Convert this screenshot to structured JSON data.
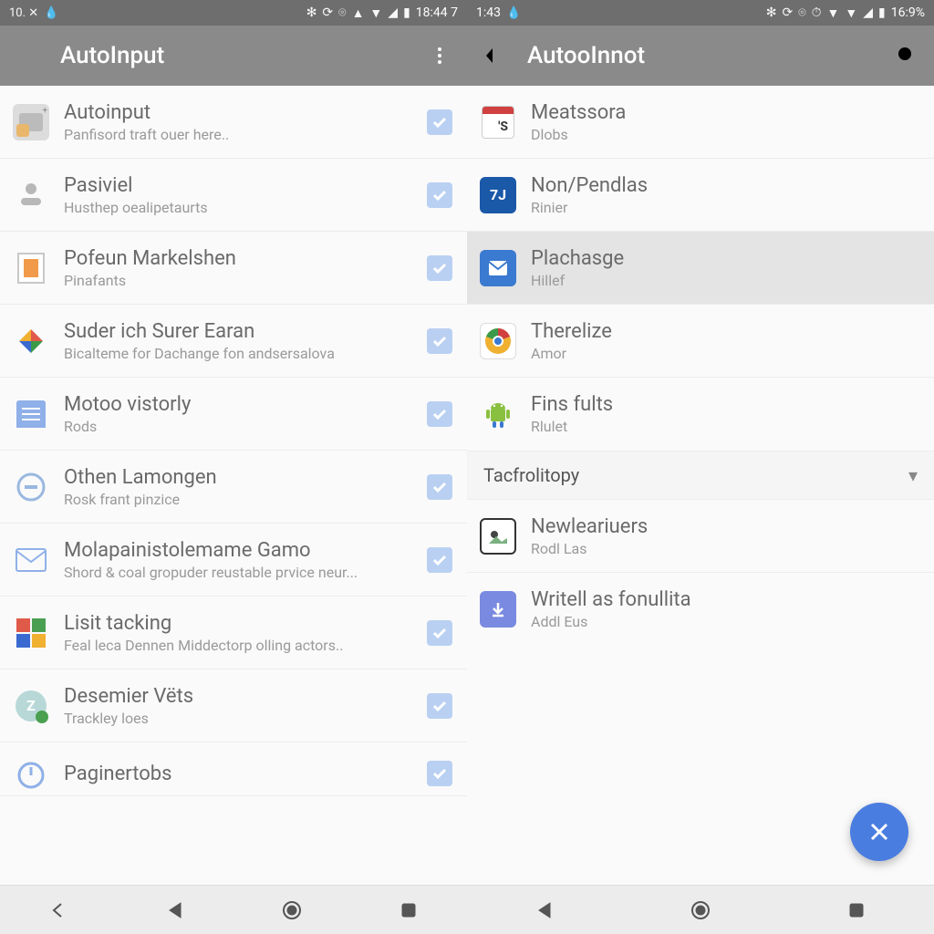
{
  "left": {
    "status": {
      "left": "10. ✕",
      "time": "18:44 7"
    },
    "appbar": {
      "title": "AutoInput"
    },
    "items": [
      {
        "title": "Autoinput",
        "sub": "Panfisord traft ouer here..",
        "checked": true
      },
      {
        "title": "Pasiviel",
        "sub": "Husthep oealipetaurts",
        "checked": true
      },
      {
        "title": "Pofeun Markelshen",
        "sub": "Pinafants",
        "checked": true
      },
      {
        "title": "Suder ich Surer Earan",
        "sub": "Bicalteme for Dachange fon andsersalova",
        "checked": true
      },
      {
        "title": "Motoo vistorly",
        "sub": "Rods",
        "checked": true
      },
      {
        "title": "Othen Lamongen",
        "sub": "Rosk frant pinzice",
        "checked": true
      },
      {
        "title": "Molapainistolemame Gamo",
        "sub": "Shord & coal gropuder reustable prvice neur...",
        "checked": true
      },
      {
        "title": "Lisit tacking",
        "sub": "Feal leca Dennen Middectorp olling actors..",
        "checked": true
      },
      {
        "title": "Desemier Vëts",
        "sub": "Trackley loes",
        "checked": true
      },
      {
        "title": "Paginertobs",
        "sub": "",
        "checked": true
      }
    ]
  },
  "right": {
    "status": {
      "left": "1:43",
      "batt": "16:9%"
    },
    "appbar": {
      "title": "AutooInnot"
    },
    "items": [
      {
        "title": "Meatssora",
        "sub": "Dlobs"
      },
      {
        "title": "Non/Pendlas",
        "sub": "Rinier"
      },
      {
        "title": "Plachasge",
        "sub": "Hillef",
        "selected": true
      },
      {
        "title": "Therelize",
        "sub": "Amor"
      },
      {
        "title": "Fins fults",
        "sub": "Rlulet"
      }
    ],
    "section": {
      "label": "Tacfrolitopy"
    },
    "items2": [
      {
        "title": "Newleariuers",
        "sub": "Rodl Las"
      },
      {
        "title": "Writell as fonullita",
        "sub": "Addl Eus"
      }
    ]
  }
}
